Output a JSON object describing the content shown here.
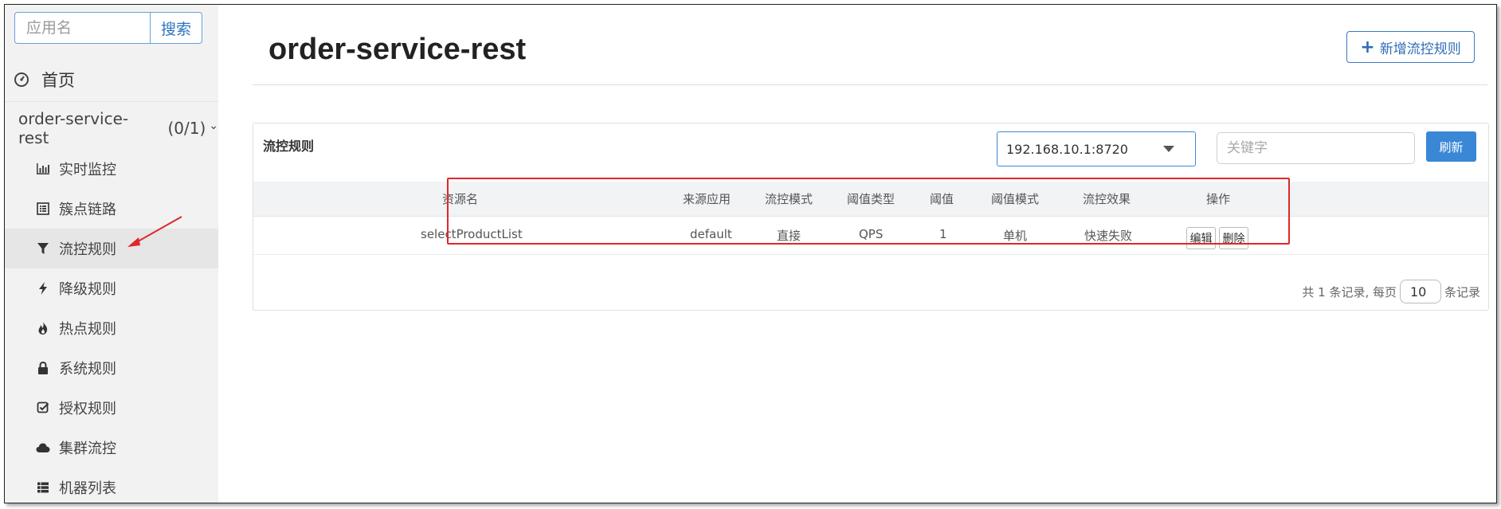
{
  "sidebar": {
    "search_placeholder": "应用名",
    "search_button": "搜索",
    "home_label": "首页",
    "app_name": "order-service-rest",
    "app_count": "(0/1)",
    "items": [
      {
        "label": "实时监控",
        "icon": "bar-chart-icon"
      },
      {
        "label": "簇点链路",
        "icon": "list-alt-icon"
      },
      {
        "label": "流控规则",
        "icon": "filter-icon",
        "active": true
      },
      {
        "label": "降级规则",
        "icon": "flash-icon"
      },
      {
        "label": "热点规则",
        "icon": "fire-icon"
      },
      {
        "label": "系统规则",
        "icon": "lock-icon"
      },
      {
        "label": "授权规则",
        "icon": "check-square-icon"
      },
      {
        "label": "集群流控",
        "icon": "cloud-icon"
      },
      {
        "label": "机器列表",
        "icon": "th-list-icon"
      }
    ]
  },
  "main": {
    "title": "order-service-rest",
    "add_button": "新增流控规则",
    "panel_title": "流控规则",
    "ip_selected": "192.168.10.1:8720",
    "keyword_placeholder": "关键字",
    "refresh_button": "刷新",
    "table": {
      "headers": [
        "资源名",
        "来源应用",
        "流控模式",
        "阈值类型",
        "阈值",
        "阈值模式",
        "流控效果",
        "操作"
      ],
      "rows": [
        {
          "resource": "selectProductList",
          "origin": "default",
          "mode": "直接",
          "grade": "QPS",
          "count": "1",
          "cluster_mode": "单机",
          "effect": "快速失败",
          "edit": "编辑",
          "delete": "删除"
        }
      ]
    },
    "pager": {
      "summary": "共 1 条记录, 每页",
      "page_size": "10",
      "suffix": "条记录"
    }
  },
  "colors": {
    "accent": "#3a87d6",
    "highlight": "#e0272a",
    "sidebar_bg": "#f2f2f2"
  }
}
